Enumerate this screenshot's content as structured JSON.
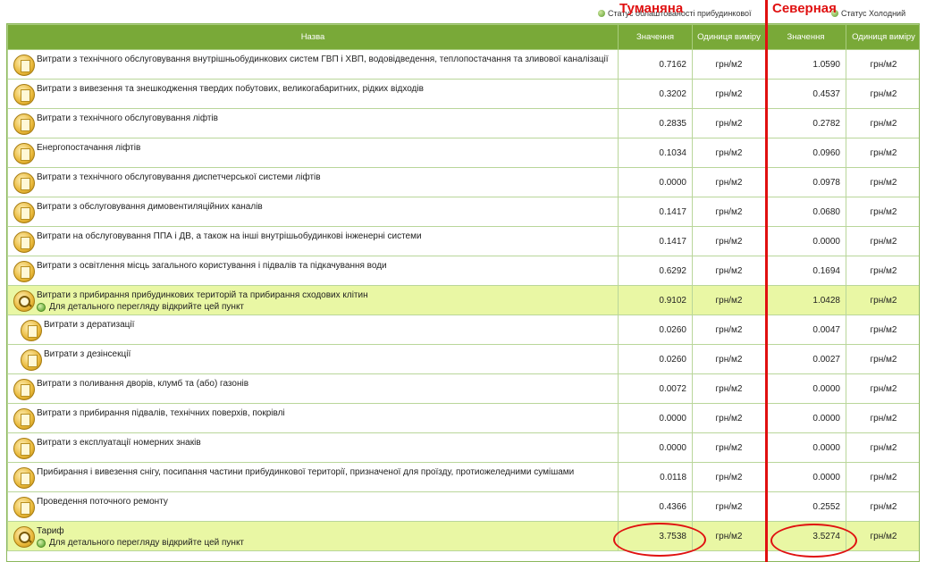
{
  "top": {
    "status_left": "Статус облаштованості прибудинкової",
    "status_right": "Статус Холодний"
  },
  "annotations": {
    "left_label": "Туманяна",
    "right_label": "Северная",
    "color": "#e01010"
  },
  "colors": {
    "header_bg": "#79a938",
    "highlight_row": "#e9f7a4"
  },
  "table": {
    "headers": {
      "name": "Назва",
      "value1": "Значення",
      "unit1": "Одиниця виміру",
      "value2": "Значення",
      "unit2": "Одиниця виміру"
    },
    "rows": [
      {
        "name": "Витрати з технічного обслуговування внутрішньобудинкових систем ГВП і ХВП, водовідведення, теплопостачання та зливової каналізації",
        "v1": "0.7162",
        "u1": "грн/м2",
        "v2": "1.0590",
        "u2": "грн/м2",
        "icon": "doc-icon"
      },
      {
        "name": "Витрати з вивезення та знешкодження твердих побутових, великогабаритних, рідких відходів",
        "v1": "0.3202",
        "u1": "грн/м2",
        "v2": "0.4537",
        "u2": "грн/м2",
        "icon": "doc-icon"
      },
      {
        "name": "Витрати з технічного обслуговування ліфтів",
        "v1": "0.2835",
        "u1": "грн/м2",
        "v2": "0.2782",
        "u2": "грн/м2",
        "icon": "doc-icon"
      },
      {
        "name": "Енергопостачання ліфтів",
        "v1": "0.1034",
        "u1": "грн/м2",
        "v2": "0.0960",
        "u2": "грн/м2",
        "icon": "doc-icon"
      },
      {
        "name": "Витрати з технічного обслуговування диспетчерської системи ліфтів",
        "v1": "0.0000",
        "u1": "грн/м2",
        "v2": "0.0978",
        "u2": "грн/м2",
        "icon": "doc-icon"
      },
      {
        "name": "Витрати з обслуговування димовентиляційних каналів",
        "v1": "0.1417",
        "u1": "грн/м2",
        "v2": "0.0680",
        "u2": "грн/м2",
        "icon": "doc-icon"
      },
      {
        "name": "Витрати на обслуговування ППА і ДВ, а також на інші внутрішьобудинкові інженерні системи",
        "v1": "0.1417",
        "u1": "грн/м2",
        "v2": "0.0000",
        "u2": "грн/м2",
        "icon": "doc-icon"
      },
      {
        "name": "Витрати з освітлення місць загального користування і підвалів та підкачування води",
        "v1": "0.6292",
        "u1": "грн/м2",
        "v2": "0.1694",
        "u2": "грн/м2",
        "icon": "doc-icon"
      },
      {
        "name": "Витрати з прибирання прибудинкових територій та прибирання сходових клітин",
        "hint": "Для детального перегляду відкрийте цей пункт",
        "v1": "0.9102",
        "u1": "грн/м2",
        "v2": "1.0428",
        "u2": "грн/м2",
        "icon": "magnifier-icon",
        "highlight": true
      },
      {
        "name": "Витрати з дератизації",
        "v1": "0.0260",
        "u1": "грн/м2",
        "v2": "0.0047",
        "u2": "грн/м2",
        "icon": "doc-icon",
        "indent": true
      },
      {
        "name": "Витрати з дезінсекції",
        "v1": "0.0260",
        "u1": "грн/м2",
        "v2": "0.0027",
        "u2": "грн/м2",
        "icon": "doc-icon",
        "indent": true
      },
      {
        "name": "Витрати з поливання дворів, клумб та (або) газонів",
        "v1": "0.0072",
        "u1": "грн/м2",
        "v2": "0.0000",
        "u2": "грн/м2",
        "icon": "doc-icon"
      },
      {
        "name": "Витрати з прибирання підвалів, технічних поверхів, покрівлі",
        "v1": "0.0000",
        "u1": "грн/м2",
        "v2": "0.0000",
        "u2": "грн/м2",
        "icon": "doc-icon"
      },
      {
        "name": "Витрати з експлуатації номерних знаків",
        "v1": "0.0000",
        "u1": "грн/м2",
        "v2": "0.0000",
        "u2": "грн/м2",
        "icon": "doc-icon"
      },
      {
        "name": "Прибирання і вивезення снігу, посипання частини прибудинкової території, призначеної для проїзду, протиожеледними сумішами",
        "v1": "0.0118",
        "u1": "грн/м2",
        "v2": "0.0000",
        "u2": "грн/м2",
        "icon": "doc-icon"
      },
      {
        "name": "Проведення поточного ремонту",
        "v1": "0.4366",
        "u1": "грн/м2",
        "v2": "0.2552",
        "u2": "грн/м2",
        "icon": "doc-icon"
      },
      {
        "name": "Тариф",
        "hint": "Для детального перегляду відкрийте цей пункт",
        "v1": "3.7538",
        "u1": "грн/м2",
        "v2": "3.5274",
        "u2": "грн/м2",
        "icon": "magnifier-icon",
        "highlight": true
      }
    ]
  }
}
